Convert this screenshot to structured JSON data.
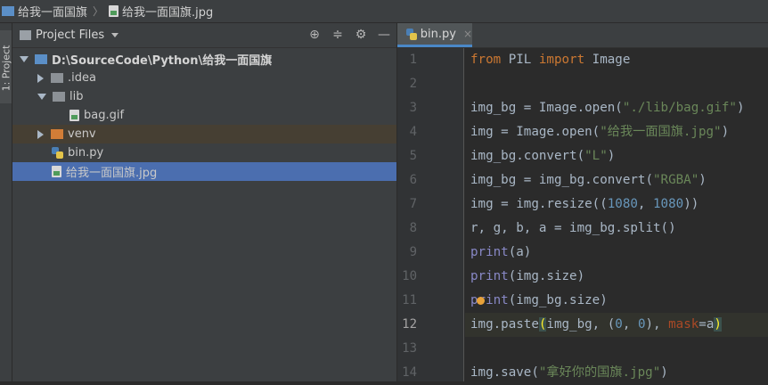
{
  "breadcrumb": {
    "project": "给我一面国旗",
    "file": "给我一面国旗.jpg"
  },
  "side_strip": {
    "tab_label": "1: Project"
  },
  "project_panel": {
    "title": "Project Files",
    "tools": [
      "target-icon",
      "collapse-icon",
      "gear-icon",
      "minimize-icon"
    ],
    "tree": [
      {
        "label": "D:\\SourceCode\\Python\\给我一面国旗",
        "depth": 0,
        "type": "folder-blue",
        "arrow": "open",
        "bold": true
      },
      {
        "label": ".idea",
        "depth": 1,
        "type": "folder-grey",
        "arrow": "closed"
      },
      {
        "label": "lib",
        "depth": 1,
        "type": "folder-grey",
        "arrow": "open"
      },
      {
        "label": "bag.gif",
        "depth": 2,
        "type": "image",
        "arrow": "none"
      },
      {
        "label": "venv",
        "depth": 1,
        "type": "folder-orange",
        "arrow": "closed",
        "highlight": "venv"
      },
      {
        "label": "bin.py",
        "depth": 1,
        "type": "python",
        "arrow": "none"
      },
      {
        "label": "给我一面国旗.jpg",
        "depth": 1,
        "type": "image",
        "arrow": "none",
        "selected": true
      }
    ]
  },
  "editor": {
    "tab_label": "bin.py",
    "tab_close": "×",
    "current_line": 12,
    "lines": [
      {
        "n": "1",
        "tokens": [
          [
            "kw",
            "from"
          ],
          [
            "t",
            " PIL "
          ],
          [
            "kw",
            "import"
          ],
          [
            "t",
            " Image"
          ]
        ]
      },
      {
        "n": "2",
        "tokens": []
      },
      {
        "n": "3",
        "tokens": [
          [
            "t",
            "img_bg = Image.open("
          ],
          [
            "str",
            "\"./lib/bag.gif\""
          ],
          [
            "t",
            ")"
          ]
        ]
      },
      {
        "n": "4",
        "tokens": [
          [
            "t",
            "img = Image.open("
          ],
          [
            "str",
            "\"给我一面国旗.jpg\""
          ],
          [
            "t",
            ")"
          ]
        ]
      },
      {
        "n": "5",
        "tokens": [
          [
            "t",
            "img_bg.convert("
          ],
          [
            "str",
            "\"L\""
          ],
          [
            "t",
            ")"
          ]
        ]
      },
      {
        "n": "6",
        "tokens": [
          [
            "t",
            "img_bg = img_bg.convert("
          ],
          [
            "str",
            "\"RGBA\""
          ],
          [
            "t",
            ")"
          ]
        ]
      },
      {
        "n": "7",
        "tokens": [
          [
            "t",
            "img = img.resize(("
          ],
          [
            "num",
            "1080"
          ],
          [
            "t",
            ", "
          ],
          [
            "num",
            "1080"
          ],
          [
            "t",
            "))"
          ]
        ]
      },
      {
        "n": "8",
        "tokens": [
          [
            "t",
            "r, g, b, a = img_bg.split()"
          ]
        ]
      },
      {
        "n": "9",
        "tokens": [
          [
            "builtin",
            "print"
          ],
          [
            "t",
            "(a)"
          ]
        ]
      },
      {
        "n": "10",
        "tokens": [
          [
            "builtin",
            "print"
          ],
          [
            "t",
            "(img.size)"
          ]
        ]
      },
      {
        "n": "11",
        "tokens": [
          [
            "builtin",
            "print"
          ],
          [
            "t",
            "(img_bg.size)"
          ]
        ]
      },
      {
        "n": "12",
        "tokens": [
          [
            "t",
            "img.paste"
          ],
          [
            "match",
            "("
          ],
          [
            "t",
            "img_bg, ("
          ],
          [
            "num",
            "0"
          ],
          [
            "t",
            ", "
          ],
          [
            "num",
            "0"
          ],
          [
            "t",
            "), "
          ],
          [
            "param",
            "mask"
          ],
          [
            "t",
            "=a"
          ],
          [
            "match",
            ")"
          ]
        ]
      },
      {
        "n": "13",
        "tokens": []
      },
      {
        "n": "14",
        "tokens": [
          [
            "t",
            "img.save("
          ],
          [
            "str",
            "\"拿好你的国旗.jpg\""
          ],
          [
            "t",
            ")"
          ]
        ]
      }
    ]
  }
}
